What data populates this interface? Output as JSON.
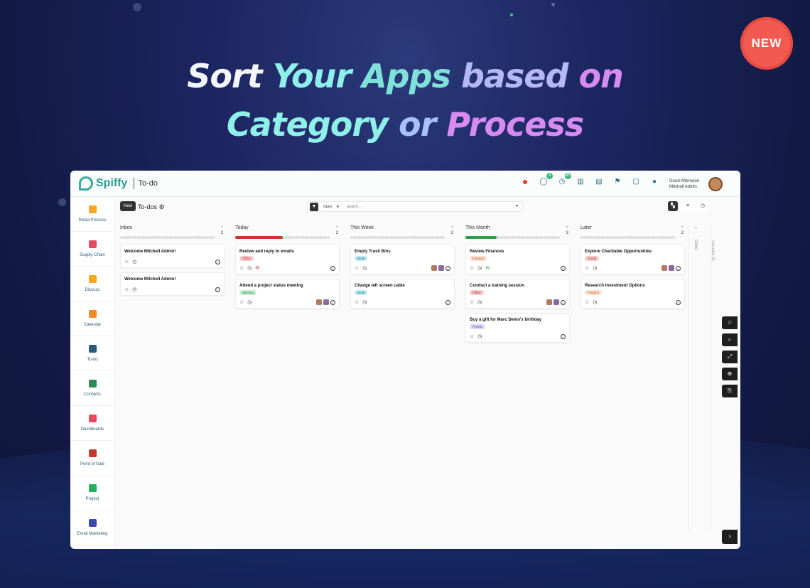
{
  "headline": {
    "line1": [
      "Sort",
      "Your",
      "Apps",
      "based",
      "on"
    ],
    "line2": [
      "Category",
      "or",
      "Process"
    ]
  },
  "badge": "NEW",
  "topbar": {
    "app_title": "To-do",
    "logo_text": "Spiffy",
    "notif_counts": {
      "chat": "4",
      "activity": "45"
    },
    "greeting": "Good Afternoon",
    "user_name": "Mitchell Admin"
  },
  "sidebar": {
    "items": [
      {
        "label": "Retail Process",
        "color": "#f6a623"
      },
      {
        "label": "Supply Chain",
        "color": "#e84a5f"
      },
      {
        "label": "Discuss",
        "color": "#f5a623"
      },
      {
        "label": "Calendar",
        "color": "#f08a24"
      },
      {
        "label": "To-do",
        "color": "#2c5a7a"
      },
      {
        "label": "Contacts",
        "color": "#2e8b57"
      },
      {
        "label": "Dashboards",
        "color": "#e84a5f"
      },
      {
        "label": "Point of Sale",
        "color": "#c0392b"
      },
      {
        "label": "Project",
        "color": "#27ae60"
      },
      {
        "label": "Email Marketing",
        "color": "#3949ab"
      }
    ]
  },
  "controls": {
    "new_label": "New",
    "breadcrumb": "To-dos",
    "filter_chip": "Open",
    "search_placeholder": "Search..."
  },
  "columns": [
    {
      "name": "Inbox",
      "count": "2",
      "progress": 0,
      "progress_color": "#cccccc",
      "cards": [
        {
          "title": "Welcome Mitchell Admin!",
          "tag": "",
          "has_mail": false,
          "avatars": 0
        },
        {
          "title": "Welcome Mitchell Admin!",
          "tag": "",
          "has_mail": false,
          "avatars": 0
        }
      ]
    },
    {
      "name": "Today",
      "count": "2",
      "progress": 0.5,
      "progress_color": "#d32f2f",
      "cards": [
        {
          "title": "Review and reply to emails",
          "tag": "Office",
          "tag_bg": "#f7c9c9",
          "tag_fg": "#a33",
          "has_mail": true,
          "avatars": 0
        },
        {
          "title": "Attend a project status meeting",
          "tag": "Meeting",
          "tag_bg": "#c9f0d4",
          "tag_fg": "#2a7a44",
          "has_mail": false,
          "avatars": 2
        }
      ]
    },
    {
      "name": "This Week",
      "count": "2",
      "progress": 0,
      "progress_color": "#cccccc",
      "cards": [
        {
          "title": "Empty Trash Bins",
          "tag": "Work",
          "tag_bg": "#bfe8ee",
          "tag_fg": "#1f6f7a",
          "has_mail": false,
          "avatars": 2
        },
        {
          "title": "Change left screen cable",
          "tag": "Work",
          "tag_bg": "#bfe8ee",
          "tag_fg": "#1f6f7a",
          "has_mail": false,
          "avatars": 0
        }
      ]
    },
    {
      "name": "This Month",
      "count": "3",
      "progress": 0.33,
      "progress_color": "#2e9e4a",
      "cards": [
        {
          "title": "Review Finances",
          "tag": "Finance",
          "tag_bg": "#fde0cf",
          "tag_fg": "#a55a2a",
          "has_mail": true,
          "avatars": 0
        },
        {
          "title": "Conduct a training session",
          "tag": "Office",
          "tag_bg": "#f7c9c9",
          "tag_fg": "#a33",
          "has_mail": false,
          "avatars": 2
        },
        {
          "title": "Buy a gift for Marc Demo's birthday",
          "tag": "Priority",
          "tag_bg": "#dcd9f7",
          "tag_fg": "#4a3fa0",
          "has_mail": false,
          "avatars": 0
        }
      ]
    },
    {
      "name": "Later",
      "count": "2",
      "progress": 0,
      "progress_color": "#cccccc",
      "cards": [
        {
          "title": "Explore Charitable Opportunities",
          "tag": "Social",
          "tag_bg": "#f7c9c9",
          "tag_fg": "#a33",
          "has_mail": false,
          "avatars": 2
        },
        {
          "title": "Research Investment Options",
          "tag": "Finance",
          "tag_bg": "#fde0cf",
          "tag_fg": "#a55a2a",
          "has_mail": false,
          "avatars": 0
        }
      ]
    }
  ],
  "done_label": "Done",
  "hidden_label": "Cancelled (1)"
}
